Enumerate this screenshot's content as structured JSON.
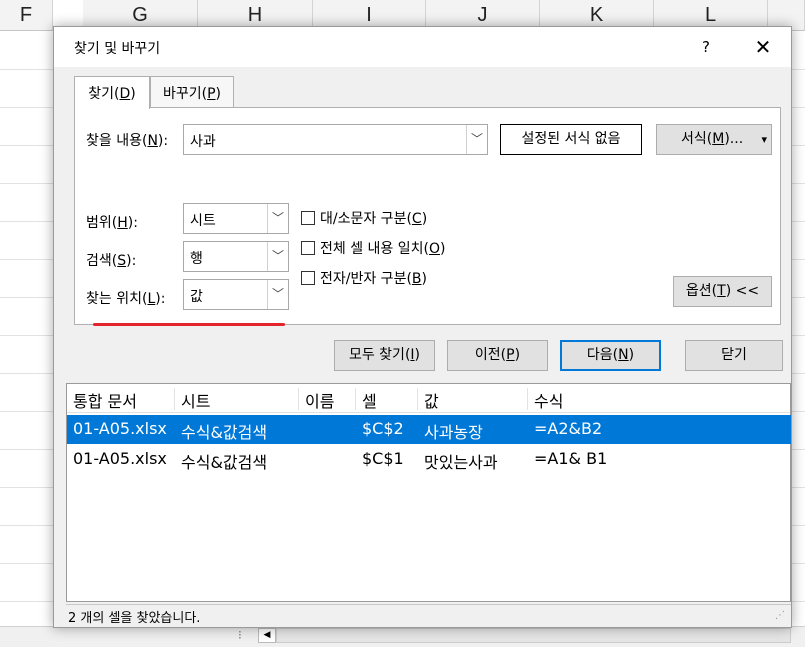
{
  "spreadsheet": {
    "columns": [
      "F",
      "G",
      "H",
      "I",
      "J",
      "K",
      "L"
    ]
  },
  "dialog": {
    "title": "찾기 및 바꾸기",
    "help": "?",
    "close": "✕",
    "tabs": [
      {
        "label": "찾기(",
        "key": "D",
        "suffix": ")"
      },
      {
        "label": "바꾸기(",
        "key": "P",
        "suffix": ")"
      }
    ],
    "find_what": {
      "label": "찾을 내용(",
      "key": "N",
      "suffix": "):",
      "value": "사과"
    },
    "format_status": "설정된 서식 없음",
    "format_button": {
      "label": "서식(",
      "key": "M",
      "suffix": ")...",
      "arrow": "▾"
    },
    "within": {
      "label": "범위(",
      "key": "H",
      "suffix": "):",
      "value": "시트"
    },
    "search": {
      "label": "검색(",
      "key": "S",
      "suffix": "):",
      "value": "행"
    },
    "look_in": {
      "label": "찾는 위치(",
      "key": "L",
      "suffix": "):",
      "value": "값"
    },
    "checkboxes": [
      {
        "label": "대/소문자 구분(",
        "key": "C",
        "suffix": ")",
        "checked": false
      },
      {
        "label": "전체 셀 내용 일치(",
        "key": "O",
        "suffix": ")",
        "checked": false
      },
      {
        "label": "전자/반자 구분(",
        "key": "B",
        "suffix": ")",
        "checked": false
      }
    ],
    "options_button": {
      "label": "옵션(",
      "key": "T",
      "suffix": ") <<"
    },
    "buttons": {
      "find_all": {
        "label": "모두 찾기(",
        "key": "I",
        "suffix": ")"
      },
      "find_prev": {
        "label": "이전(",
        "key": "P",
        "suffix": ")"
      },
      "find_next": {
        "label": "다음(",
        "key": "N",
        "suffix": ")"
      },
      "close": "닫기"
    },
    "results": {
      "headers": [
        "통합 문서",
        "시트",
        "이름",
        "셀",
        "값",
        "수식"
      ],
      "rows": [
        {
          "workbook": "01-A05.xlsx",
          "sheet": "수식&값검색",
          "name": "",
          "cell": "$C$2",
          "value": "사과농장",
          "formula": "=A2&B2",
          "selected": true
        },
        {
          "workbook": "01-A05.xlsx",
          "sheet": "수식&값검색",
          "name": "",
          "cell": "$C$1",
          "value": "맛있는사과",
          "formula": "=A1& B1",
          "selected": false
        }
      ]
    },
    "status": "2 개의 셀을 찾았습니다."
  },
  "colors": {
    "selection": "#0078d7",
    "annotation_underline": "#e3242b",
    "primary_border": "#0078d7"
  }
}
